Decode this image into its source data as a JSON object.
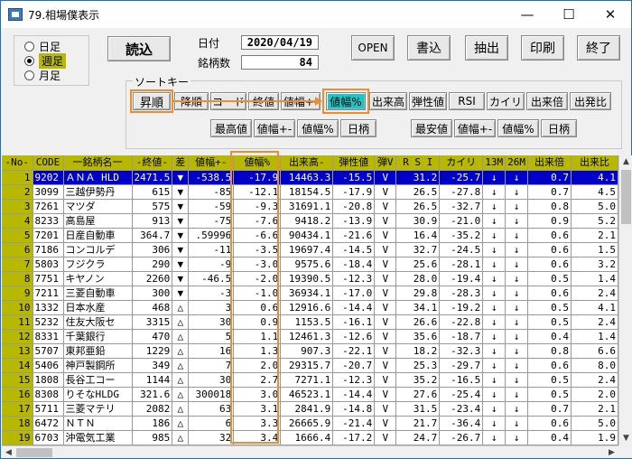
{
  "window": {
    "title": "79.相場僕表示",
    "minimize": "—",
    "maximize": "☐",
    "close": "✕"
  },
  "period": {
    "options": [
      "日足",
      "週足",
      "月足"
    ],
    "selected": "週足"
  },
  "toolbar": {
    "load": "読込",
    "date_label": "日付",
    "date_value": "2020/04/19",
    "count_label": "銘柄数",
    "count_value": "84",
    "open": "OPEN",
    "write": "書込",
    "extract": "抽出",
    "print": "印刷",
    "exit": "終了"
  },
  "sort": {
    "label": "ソートキー",
    "asc": "昇順",
    "desc": "降順",
    "keys_row1": [
      "コード",
      "終値",
      "値幅+-",
      "値幅%",
      "出来高",
      "弾性値",
      "RSI",
      "カイリ",
      "出来倍",
      "出発比"
    ],
    "active_key": "値幅%",
    "high_label": "最高値",
    "high_keys": [
      "値幅+-",
      "値幅%",
      "日柄"
    ],
    "low_label": "最安値",
    "low_keys": [
      "値幅+-",
      "値幅%",
      "日柄"
    ]
  },
  "grid": {
    "headers": [
      "-No-",
      "CODE",
      "一銘柄名一",
      "-終値-",
      "差",
      "値幅+-",
      "値幅%",
      "出来高-",
      "弾性値",
      "弾V",
      "R S I",
      "カイリ",
      "13M",
      "26M",
      "出来倍",
      "出来比"
    ],
    "rows": [
      [
        "1",
        "9202",
        "ＡＮＡ HLD",
        "2471.5",
        "▼",
        "-538.5",
        "-17.9",
        "14463.3",
        "-15.5",
        "V",
        "31.2",
        "-25.7",
        "↓",
        "↓",
        "0.7",
        "4.1"
      ],
      [
        "2",
        "3099",
        "三越伊勢丹",
        "615",
        "▼",
        "-85",
        "-12.1",
        "18154.5",
        "-17.9",
        "V",
        "26.5",
        "-27.8",
        "↓",
        "↓",
        "0.7",
        "4.5"
      ],
      [
        "3",
        "7261",
        "マツダ",
        "575",
        "▼",
        "-59",
        "-9.3",
        "31691.1",
        "-20.8",
        "V",
        "26.5",
        "-32.7",
        "↓",
        "↓",
        "0.8",
        "5.0"
      ],
      [
        "4",
        "8233",
        "高島屋",
        "913",
        "▼",
        "-75",
        "-7.6",
        "9418.2",
        "-13.9",
        "V",
        "30.9",
        "-21.0",
        "↓",
        "↓",
        "0.9",
        "5.2"
      ],
      [
        "5",
        "7201",
        "日産自動車",
        "364.7",
        "▼",
        ".59996",
        "-6.6",
        "90434.1",
        "-21.6",
        "V",
        "16.4",
        "-35.2",
        "↓",
        "↓",
        "0.6",
        "2.1"
      ],
      [
        "6",
        "7186",
        "コンコルデ",
        "306",
        "▼",
        "-11",
        "-3.5",
        "19697.4",
        "-14.5",
        "V",
        "32.7",
        "-24.5",
        "↓",
        "↓",
        "0.6",
        "1.5"
      ],
      [
        "7",
        "5803",
        "フジクラ",
        "290",
        "▼",
        "-9",
        "-3.0",
        "9575.6",
        "-18.4",
        "V",
        "25.6",
        "-28.1",
        "↓",
        "↓",
        "0.6",
        "3.2"
      ],
      [
        "8",
        "7751",
        "キヤノン",
        "2260",
        "▼",
        "-46.5",
        "-2.0",
        "19390.5",
        "-12.3",
        "V",
        "28.0",
        "-19.4",
        "↓",
        "↓",
        "0.5",
        "1.4"
      ],
      [
        "9",
        "7211",
        "三菱自動車",
        "300",
        "▼",
        "-3",
        "-1.0",
        "36934.1",
        "-17.0",
        "V",
        "29.8",
        "-28.3",
        "↓",
        "↓",
        "0.6",
        "2.4"
      ],
      [
        "10",
        "1332",
        "日本水産",
        "468",
        "△",
        "3",
        "0.6",
        "12916.6",
        "-14.4",
        "V",
        "34.1",
        "-19.2",
        "↓",
        "↓",
        "0.5",
        "4.1"
      ],
      [
        "11",
        "5232",
        "住友大阪セ",
        "3315",
        "△",
        "30",
        "0.9",
        "1153.5",
        "-16.1",
        "V",
        "26.6",
        "-22.8",
        "↓",
        "↓",
        "0.5",
        "2.4"
      ],
      [
        "12",
        "8331",
        "千葉銀行",
        "470",
        "△",
        "5",
        "1.1",
        "12461.3",
        "-12.6",
        "V",
        "35.6",
        "-18.7",
        "↓",
        "↓",
        "0.4",
        "1.4"
      ],
      [
        "13",
        "5707",
        "東邦亜鉛",
        "1229",
        "△",
        "16",
        "1.3",
        "907.3",
        "-22.1",
        "V",
        "18.2",
        "-32.3",
        "↓",
        "↓",
        "0.8",
        "6.6"
      ],
      [
        "14",
        "5406",
        "神戸製鋼所",
        "349",
        "△",
        "7",
        "2.0",
        "29315.7",
        "-20.7",
        "V",
        "25.3",
        "-29.7",
        "↓",
        "↓",
        "0.6",
        "8.0"
      ],
      [
        "15",
        "1808",
        "長谷工コー",
        "1144",
        "△",
        "30",
        "2.7",
        "7271.1",
        "-12.3",
        "V",
        "35.2",
        "-16.5",
        "↓",
        "↓",
        "0.5",
        "2.4"
      ],
      [
        "16",
        "8308",
        "りそなHLDG",
        "321.6",
        "△",
        "300018",
        "3.0",
        "46523.1",
        "-14.4",
        "V",
        "27.6",
        "-25.4",
        "↓",
        "↓",
        "0.5",
        "2.0"
      ],
      [
        "17",
        "5711",
        "三菱マテリ",
        "2082",
        "△",
        "63",
        "3.1",
        "2841.9",
        "-14.8",
        "V",
        "31.5",
        "-23.4",
        "↓",
        "↓",
        "0.7",
        "2.1"
      ],
      [
        "18",
        "6472",
        "ＮＴＮ",
        "186",
        "△",
        "6",
        "3.3",
        "26665.9",
        "-21.4",
        "V",
        "21.7",
        "-36.4",
        "↓",
        "↓",
        "0.6",
        "5.0"
      ],
      [
        "19",
        "6703",
        "沖電気工業",
        "985",
        "△",
        "32",
        "3.4",
        "1666.4",
        "-17.2",
        "V",
        "24.7",
        "-26.7",
        "↓",
        "↓",
        "0.4",
        "1.9"
      ]
    ]
  }
}
